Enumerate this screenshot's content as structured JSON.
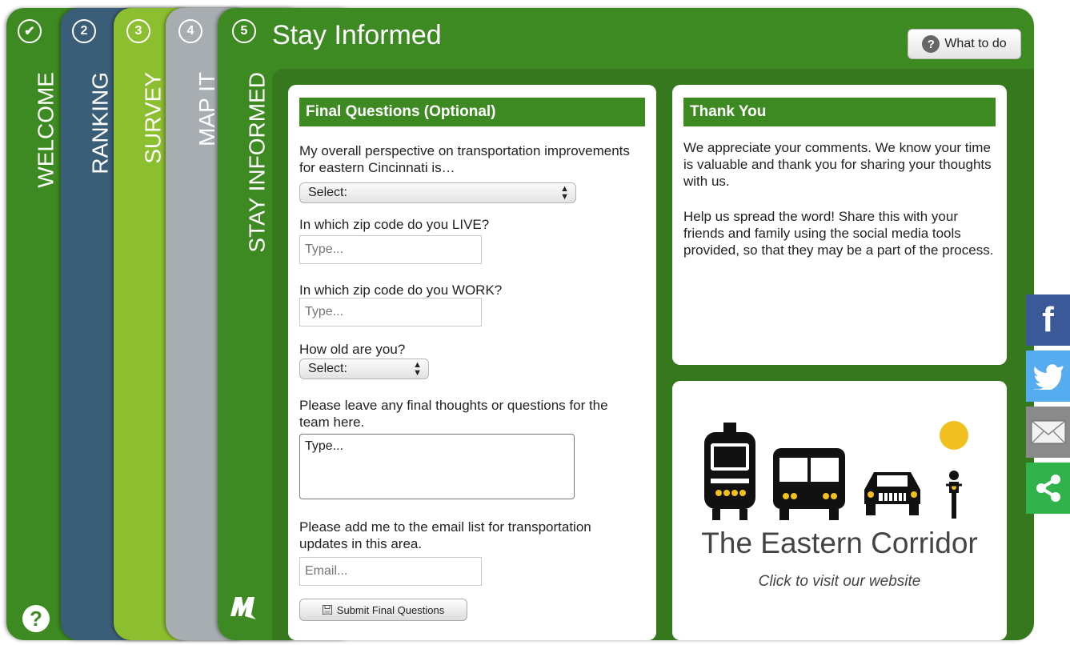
{
  "tabs": [
    {
      "number": "✔",
      "label": "WELCOME",
      "color": "#3e8a22"
    },
    {
      "number": "2",
      "label": "RANKING",
      "color": "#3b5e78"
    },
    {
      "number": "3",
      "label": "SURVEY",
      "color": "#8cbf2f"
    },
    {
      "number": "4",
      "label": "MAP IT",
      "color": "#a8adb1"
    },
    {
      "number": "5",
      "label": "STAY INFORMED",
      "color": "#3e8a22"
    }
  ],
  "help_icon": "?",
  "page_title": "Stay Informed",
  "what_to_do": {
    "icon": "?",
    "label": "What to do"
  },
  "questions": {
    "header": "Final Questions (Optional)",
    "q1": "My overall perspective on transportation improvements for eastern Cincinnati is…",
    "q1_select": "Select:",
    "q2": "In which zip code do you LIVE?",
    "q2_placeholder": "Type...",
    "q3": "In which zip code do you WORK?",
    "q3_placeholder": "Type...",
    "q4": "How old are you?",
    "q4_select": "Select:",
    "q5": "Please leave any final thoughts or questions for the team here.",
    "q5_placeholder": "Type...",
    "q6": "Please add me to the email list for transportation updates in this area.",
    "q6_placeholder": "Email...",
    "submit": "Submit Final Questions"
  },
  "thanks": {
    "header": "Thank You",
    "p1": "We appreciate your comments. We know your time is valuable and thank you for sharing your thoughts with us.",
    "p2": "Help us spread the word! Share this with your friends and family using the social media tools provided, so that they may be a part of the process."
  },
  "logo": {
    "title": "The Eastern Corridor",
    "subtitle": "Click to visit our website",
    "sun_color": "#f0c020"
  },
  "social": {
    "facebook": "f",
    "icons": [
      "facebook-icon",
      "twitter-icon",
      "email-icon",
      "share-icon"
    ]
  }
}
